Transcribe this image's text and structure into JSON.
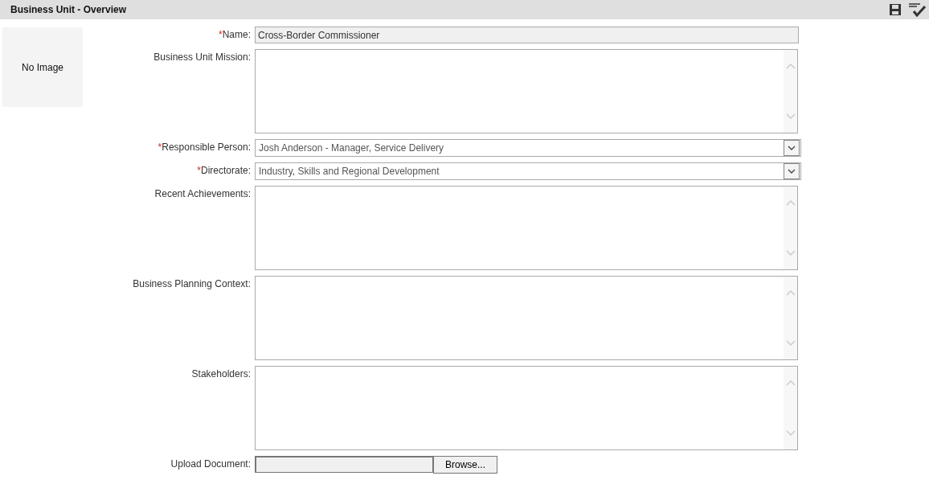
{
  "header": {
    "title": "Business Unit - Overview"
  },
  "image_placeholder": {
    "text": "No Image"
  },
  "fields": [
    {
      "kind": "text",
      "required_mark": "*",
      "label": "Name:",
      "value": "Cross-Border Commissioner"
    },
    {
      "kind": "textarea",
      "label": "Business Unit Mission:"
    },
    {
      "kind": "select",
      "required_mark": "*",
      "label": "Responsible Person:",
      "value": "Josh Anderson - Manager, Service Delivery"
    },
    {
      "kind": "select",
      "required_mark": "*",
      "label": "Directorate:",
      "value": "Industry, Skills and Regional Development"
    },
    {
      "kind": "textarea",
      "label": "Recent Achievements:"
    },
    {
      "kind": "textarea",
      "label": "Business Planning Context:"
    },
    {
      "kind": "textarea",
      "label": "Stakeholders:"
    },
    {
      "kind": "file",
      "label": "Upload Document:",
      "button": "Browse..."
    }
  ]
}
